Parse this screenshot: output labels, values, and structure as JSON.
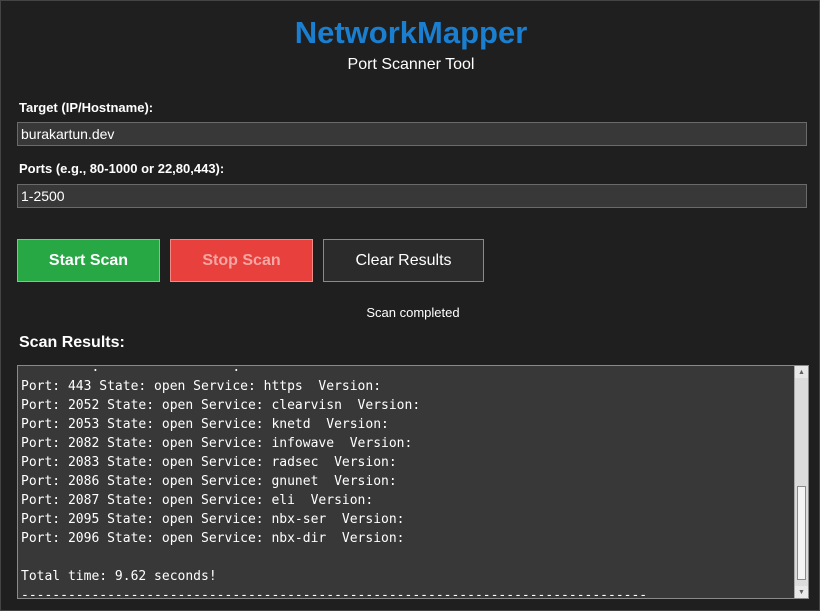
{
  "app": {
    "title": "NetworkMapper",
    "subtitle": "Port Scanner Tool"
  },
  "form": {
    "target_label": "Target (IP/Hostname):",
    "target_value": "burakartun.dev",
    "ports_label": "Ports (e.g., 80-1000 or 22,80,443):",
    "ports_value": "1-2500"
  },
  "buttons": {
    "start": "Start Scan",
    "stop": "Stop Scan",
    "clear": "Clear Results"
  },
  "status": "Scan completed",
  "results": {
    "heading": "Scan Results:",
    "lines": [
      "         .                 .",
      "Port: 443 State: open Service: https  Version:",
      "Port: 2052 State: open Service: clearvisn  Version:",
      "Port: 2053 State: open Service: knetd  Version:",
      "Port: 2082 State: open Service: infowave  Version:",
      "Port: 2083 State: open Service: radsec  Version:",
      "Port: 2086 State: open Service: gnunet  Version:",
      "Port: 2087 State: open Service: eli  Version:",
      "Port: 2095 State: open Service: nbx-ser  Version:",
      "Port: 2096 State: open Service: nbx-dir  Version:",
      "",
      "Total time: 9.62 seconds!",
      "--------------------------------------------------------------------------------"
    ]
  },
  "colors": {
    "title": "#1a7fd0",
    "start_button": "#28a745",
    "stop_button": "#e8413d",
    "background": "#1f1f1f",
    "field": "#383838"
  }
}
